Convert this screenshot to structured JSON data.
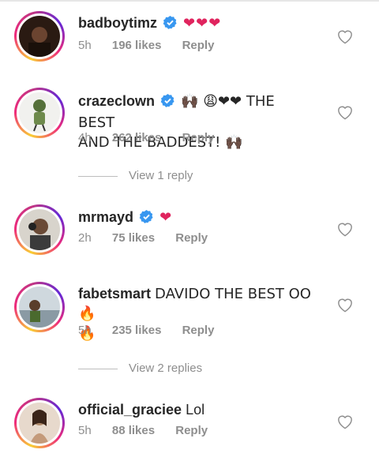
{
  "comments": [
    {
      "username": "badboytimz",
      "verified": true,
      "text": "❤❤❤",
      "text2": "",
      "time": "5h",
      "likes": "196 likes",
      "reply": "Reply"
    },
    {
      "username": "crazeclown",
      "verified": true,
      "text": "🙌🏿 😩❤❤ THE BEST",
      "text2": "AND THE BADDEST! 🙌🏿",
      "time": "4h",
      "likes": "262 likes",
      "reply": "Reply"
    },
    {
      "username": "mrmayd",
      "verified": true,
      "text": "❤",
      "text2": "",
      "time": "2h",
      "likes": "75 likes",
      "reply": "Reply"
    },
    {
      "username": "fabetsmart",
      "verified": false,
      "text": "DAVIDO THE BEST OO🔥",
      "text2": "🔥",
      "time": "5h",
      "likes": "235 likes",
      "reply": "Reply"
    },
    {
      "username": "official_graciee",
      "verified": false,
      "text": "Lol",
      "text2": "",
      "time": "5h",
      "likes": "88 likes",
      "reply": "Reply"
    }
  ],
  "view_replies": [
    "View 1 reply",
    "View 2 replies"
  ],
  "colors": {
    "verified_blue": "#3897f0",
    "heart_red": "#ed4956",
    "meta_grey": "#8e8e8e"
  },
  "icons": {
    "like": "heart-outline-icon",
    "verified": "verified-badge-icon"
  }
}
